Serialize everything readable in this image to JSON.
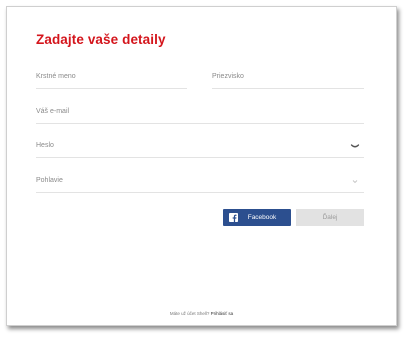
{
  "title": "Zadajte vaše detaily",
  "fields": {
    "first_name": "Krstné meno",
    "last_name": "Priezvisko",
    "email": "Váš e-mail",
    "password": "Heslo",
    "gender": "Pohlavie"
  },
  "icons": {
    "password_toggle": "eye-closed-icon",
    "gender_dropdown": "chevron-down-icon",
    "facebook": "facebook-icon"
  },
  "buttons": {
    "facebook": "Facebook",
    "next": "Ďalej"
  },
  "footer": {
    "text": "Máte už účet Shell?",
    "link": "Prihlásiť sa"
  },
  "colors": {
    "accent": "#d4151c",
    "facebook": "#2c4f8f",
    "disabled": "#e2e2e2"
  }
}
